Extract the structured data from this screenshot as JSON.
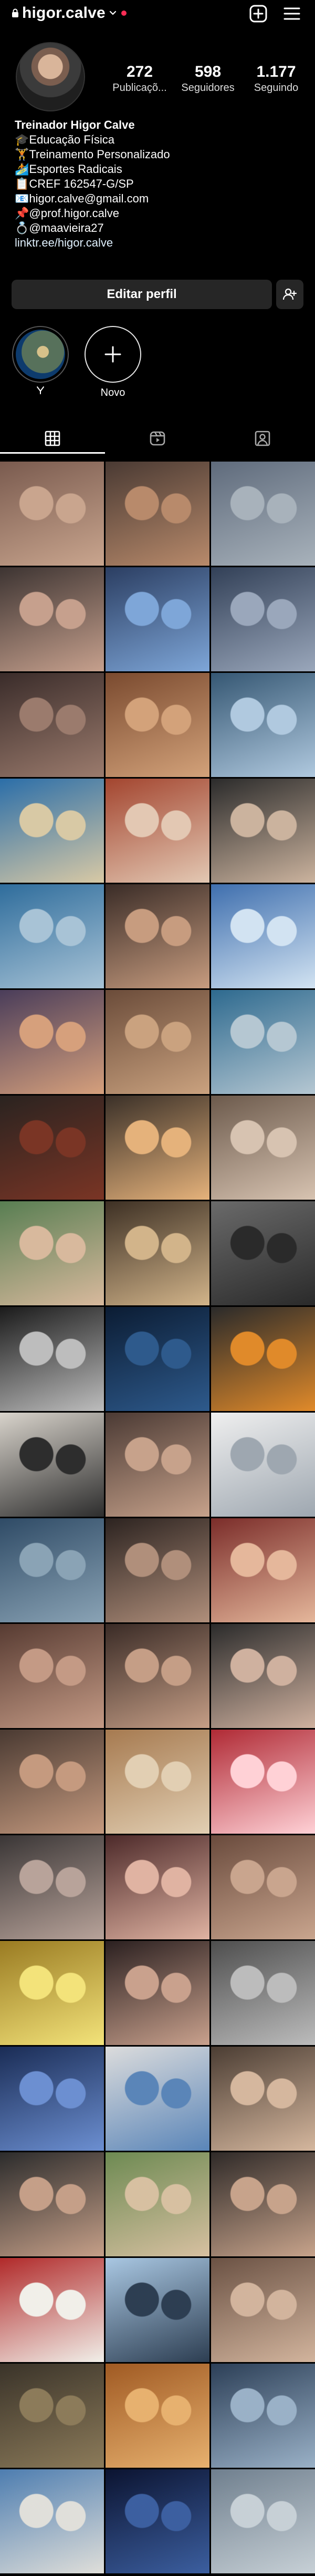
{
  "header": {
    "username": "higor.calve",
    "icons": [
      "lock-icon",
      "chevron-down-icon",
      "notification-dot",
      "new-post-icon",
      "menu-icon"
    ]
  },
  "stats": {
    "posts_count": "272",
    "posts_label": "Publicaçõ...",
    "followers_count": "598",
    "followers_label": "Seguidores",
    "following_count": "1.177",
    "following_label": "Seguindo"
  },
  "bio": {
    "name": "Treinador Higor Calve",
    "lines": [
      "🎓Educação Física",
      "🏋️Treinamento Personalizado",
      "🏄Esportes Radicais",
      "📋CREF 162547-G/SP",
      "📧higor.calve@gmail.com",
      "📌@prof.higor.calve",
      "💍@maavieira27"
    ],
    "link": "linktr.ee/higor.calve"
  },
  "actions": {
    "edit_profile_label": "Editar perfil"
  },
  "highlights": [
    {
      "label": ""
    },
    {
      "label": "Novo"
    }
  ],
  "tabs": [
    {
      "name": "grid",
      "icon": "grid-icon",
      "active": true
    },
    {
      "name": "reels",
      "icon": "reels-icon",
      "active": false
    },
    {
      "name": "tagged",
      "icon": "tagged-icon",
      "active": false
    }
  ],
  "grid": {
    "tile_colors": [
      [
        "#7a5b4f",
        "#c9a58e"
      ],
      [
        "#4a3a33",
        "#b88a6b"
      ],
      [
        "#5f6b7c",
        "#a8b2bb"
      ],
      [
        "#3d3432",
        "#c6a08d"
      ],
      [
        "#2b3e62",
        "#7ea6d8"
      ],
      [
        "#324057",
        "#9aa7bb"
      ],
      [
        "#3a2c2a",
        "#9b7b6d"
      ],
      [
        "#7a4a2f",
        "#d3a27a"
      ],
      [
        "#355773",
        "#b0c9df"
      ],
      [
        "#2b6ea8",
        "#d8c9a5"
      ],
      [
        "#a3452f",
        "#e3c8b3"
      ],
      [
        "#2b2b2b",
        "#cbb39e"
      ],
      [
        "#2f6d9c",
        "#a8c3d6"
      ],
      [
        "#3a2c27",
        "#c79c7f"
      ],
      [
        "#3f6fae",
        "#d2e3f2"
      ],
      [
        "#4a3d5a",
        "#d6a07c"
      ],
      [
        "#6b4c3a",
        "#caa27f"
      ],
      [
        "#2e6a8f",
        "#b5c7d2"
      ],
      [
        "#2a2320",
        "#7a3525"
      ],
      [
        "#3a3028",
        "#e5b27b"
      ],
      [
        "#6c5a4c",
        "#d7c3b1"
      ],
      [
        "#587e52",
        "#d8b99d"
      ],
      [
        "#3d3024",
        "#d2b48a"
      ],
      [
        "#6a6a6a",
        "#2a2a2a"
      ],
      [
        "#1b1b1b",
        "#bdbdbd"
      ],
      [
        "#0b1c33",
        "#2e5a8c"
      ],
      [
        "#2a2a2a",
        "#e08a2a"
      ],
      [
        "#d8d3cb",
        "#2d2d2d"
      ],
      [
        "#4b3a34",
        "#c7a28b"
      ],
      [
        "#efefef",
        "#9ea7b0"
      ],
      [
        "#2f4b66",
        "#8aa3b5"
      ],
      [
        "#2c2320",
        "#b08f7b"
      ],
      [
        "#7b2d2a",
        "#e5b79b"
      ],
      [
        "#573b32",
        "#c49a85"
      ],
      [
        "#3a2b26",
        "#c59e86"
      ],
      [
        "#2b2b2b",
        "#cfb19f"
      ],
      [
        "#4a3a32",
        "#c59a7f"
      ],
      [
        "#a67a50",
        "#e2cfb3"
      ],
      [
        "#b02a35",
        "#ffd1d6"
      ],
      [
        "#3a3636",
        "#b8a39a"
      ],
      [
        "#4d2a2a",
        "#e0b3a2"
      ],
      [
        "#6a4b3d",
        "#c9a58e"
      ],
      [
        "#9a7b22",
        "#f3e37a"
      ],
      [
        "#2b2020",
        "#c9a18d"
      ],
      [
        "#4e4e4e",
        "#bcbcbc"
      ],
      [
        "#1a2c55",
        "#6c8fd1"
      ],
      [
        "#dcdcdc",
        "#5a85b8"
      ],
      [
        "#4b3d33",
        "#d5b79e"
      ],
      [
        "#2c2c2c",
        "#c59f88"
      ],
      [
        "#6d8a52",
        "#d7c0a1"
      ],
      [
        "#2f2a28",
        "#c7a38b"
      ],
      [
        "#b12a2a",
        "#f1efe9"
      ],
      [
        "#a9c7e2",
        "#2d3e52"
      ],
      [
        "#6b5244",
        "#d2b49d"
      ],
      [
        "#3a3329",
        "#8c7b5a"
      ],
      [
        "#a05a23",
        "#e7b16f"
      ],
      [
        "#2c3f57",
        "#9ab1c7"
      ],
      [
        "#4d7db0",
        "#e0dfda"
      ],
      [
        "#0b1330",
        "#3c5fa0"
      ],
      [
        "#6f7f8e",
        "#c7d0d6"
      ]
    ]
  }
}
